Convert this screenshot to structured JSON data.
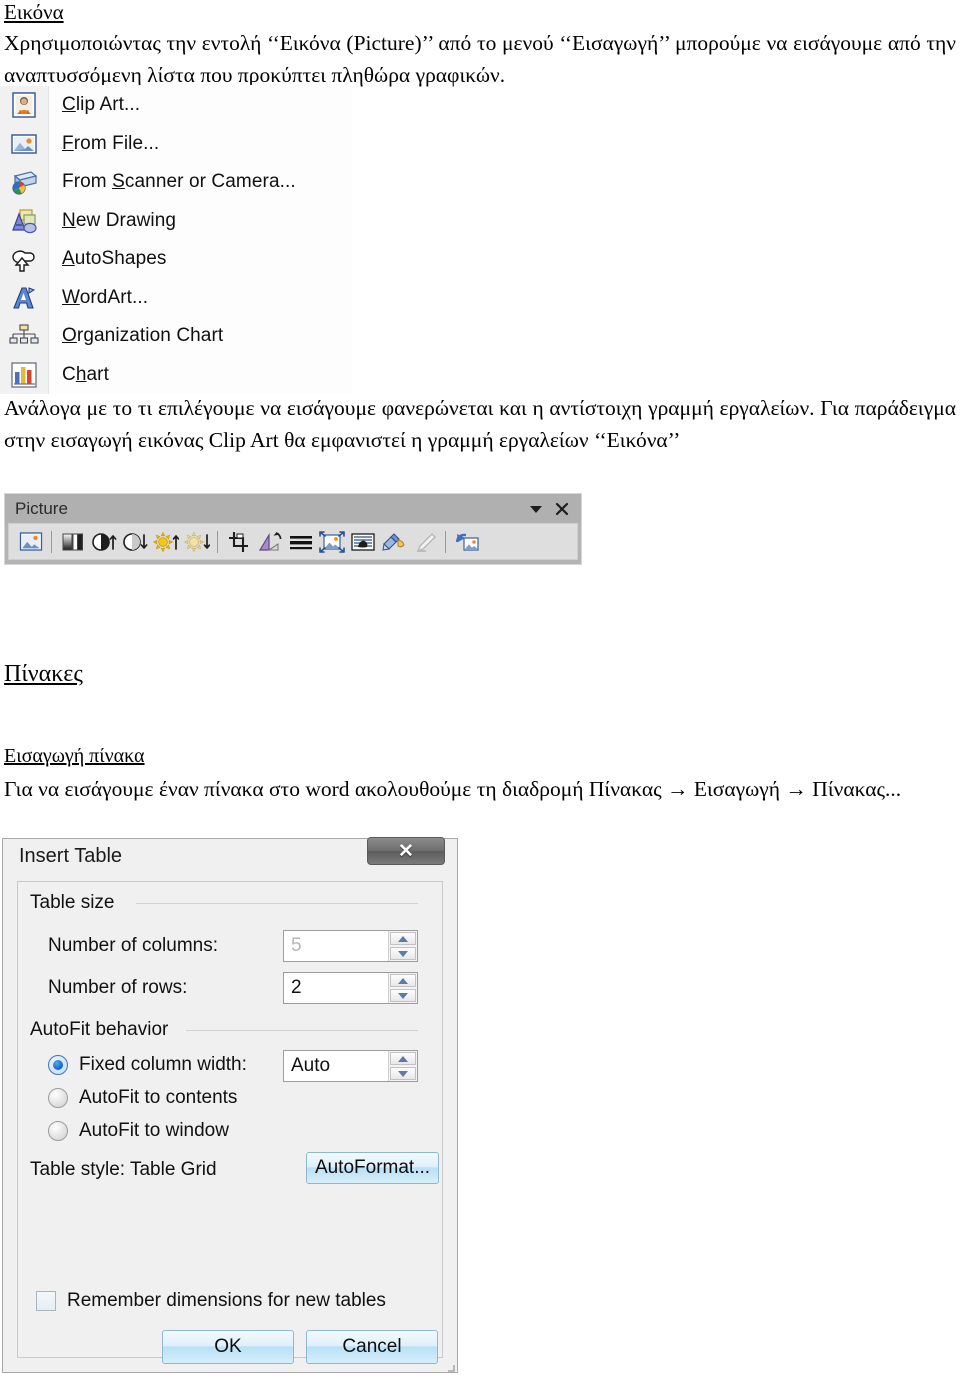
{
  "document": {
    "section_heading": "Εικόνα",
    "paragraph_1": "Χρησιμοποιώντας την εντολή ‘‘Εικόνα (Picture)’’ από το μενού ‘‘Εισαγωγή’’ μπορούμε να εισάγουμε από την αναπτυσσόμενη λίστα που προκύπτει πληθώρα γραφικών.",
    "paragraph_2": "Ανάλογα με το τι επιλέγουμε να εισάγουμε φανερώνεται και η αντίστοιχη γραμμή εργαλείων. Για παράδειγμα στην εισαγωγή εικόνας Clip Art θα εμφανιστεί η γραμμή εργαλείων ‘‘Εικόνα’’",
    "section_heading_2": "Πίνακες",
    "sub_heading": "Εισαγωγή πίνακα",
    "paragraph_3": "Για να εισάγουμε έναν πίνακα στο word ακολουθούμε τη διαδρομή Πίνακας → Εισαγωγή → Πίνακας..."
  },
  "picture_menu": {
    "items": [
      {
        "label": "Clip Art...",
        "accel": "C",
        "icon": "clip-art-icon"
      },
      {
        "label": "From File...",
        "accel": "F",
        "icon": "from-file-icon"
      },
      {
        "label": "From Scanner or Camera...",
        "accel": "S",
        "icon": "scanner-camera-icon"
      },
      {
        "label": "New Drawing",
        "accel": "N",
        "icon": "new-drawing-icon"
      },
      {
        "label": "AutoShapes",
        "accel": "A",
        "icon": "autoshapes-icon"
      },
      {
        "label": "WordArt...",
        "accel": "W",
        "icon": "wordart-icon"
      },
      {
        "label": "Organization Chart",
        "accel": "O",
        "icon": "organization-chart-icon"
      },
      {
        "label": "Chart",
        "accel": "h",
        "icon": "chart-icon"
      }
    ]
  },
  "picture_toolbar": {
    "title": "Picture",
    "dropdown_icon": "chevron-down-icon",
    "close_icon": "close-icon",
    "buttons": [
      "insert-picture-icon",
      "color-icon",
      "more-contrast-icon",
      "less-contrast-icon",
      "more-brightness-icon",
      "less-brightness-icon",
      "crop-icon",
      "rotate-left-icon",
      "line-style-icon",
      "compress-pictures-icon",
      "text-wrapping-icon",
      "format-picture-icon",
      "set-transparent-color-icon",
      "reset-picture-icon"
    ]
  },
  "insert_table_dialog": {
    "title": "Insert Table",
    "close_label": "✕",
    "table_size_group": "Table size",
    "columns_label": "Number of columns:",
    "columns_value": "5",
    "rows_label": "Number of rows:",
    "rows_value": "2",
    "autofit_group": "AutoFit behavior",
    "radios": [
      {
        "label": "Fixed column width:",
        "selected": true
      },
      {
        "label": "AutoFit to contents",
        "selected": false
      },
      {
        "label": "AutoFit to window",
        "selected": false
      }
    ],
    "fixed_width_value": "Auto",
    "table_style_label": "Table style:  Table Grid",
    "autoformat_button": "AutoFormat...",
    "remember_checkbox_label": "Remember dimensions for new tables",
    "remember_checked": false,
    "ok_button": "OK",
    "cancel_button": "Cancel"
  },
  "colors": {
    "menu_gutter": "#f1f1f1",
    "toolbar_frame": "#b4b4b4",
    "toolbar_body": "#dedede",
    "dialog_bg": "#f0f0f0",
    "button_accent": "#b9e0f5",
    "radio_accent": "#0c5fc0"
  }
}
